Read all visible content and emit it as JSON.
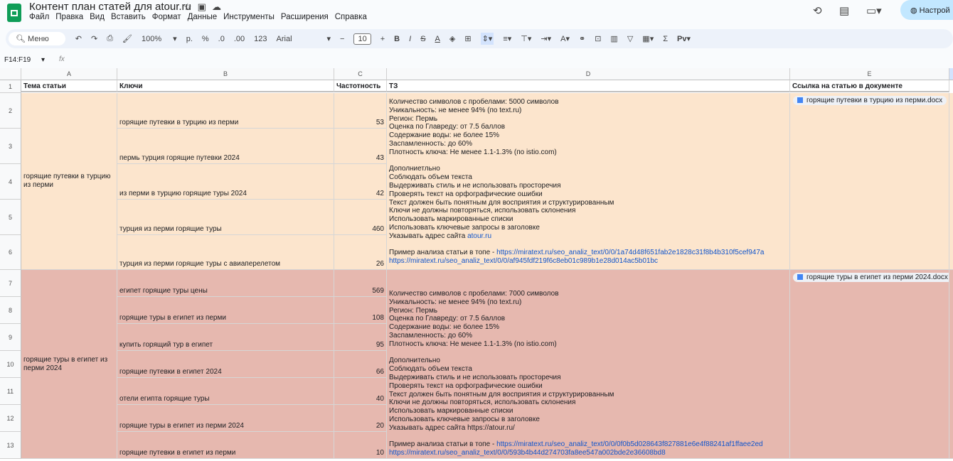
{
  "title": "Контент план статей для atour.ru",
  "menu": [
    "Файл",
    "Правка",
    "Вид",
    "Вставить",
    "Формат",
    "Данные",
    "Инструменты",
    "Расширения",
    "Справка"
  ],
  "share_label": "Настрой",
  "toolbar": {
    "search": "Меню",
    "zoom": "100%",
    "currency": "р.",
    "percent": "%",
    "dec_less": ".0",
    "dec_more": ".00",
    "format123": "123",
    "font": "Arial",
    "font_size": "10"
  },
  "name_box": "F14:F19",
  "fx": "fx",
  "columns": [
    "A",
    "B",
    "C",
    "D",
    "E"
  ],
  "headers": [
    "Тема статьи",
    "Ключи",
    "Частотность",
    "ТЗ",
    "Ссылка на статью в документе"
  ],
  "row_numbers": [
    "1",
    "2",
    "3",
    "4",
    "5",
    "6",
    "7",
    "8",
    "9",
    "10",
    "11",
    "12",
    "13"
  ],
  "groups": [
    {
      "topic": "горящие путевки в турцию из перми",
      "keys": [
        [
          "горящие путевки в турцию из перми",
          "53"
        ],
        [
          "пермь турция горящие путевки 2024",
          "43"
        ],
        [
          "из перми в турцию горящие туры 2024",
          "42"
        ],
        [
          "турция из перми горящие туры",
          "460"
        ],
        [
          "турция из перми горящие туры с авиаперелетом",
          "26"
        ]
      ],
      "tz": "Количество символов с пробелами: 5000 символов\nУникальность: не менее 94% (по text.ru)\nРегион: Пермь\nОценка по Главреду: от 7.5 баллов\nСодержание воды: не более 15%\nЗаспамленность: до 60%\nПлотность ключа: Не менее 1.1-1.3% (по istio.com)\n\nДополниетльно\nСоблюдать объем текста\nВыдерживать стиль и не использовать просторечия\nПроверять текст на орфографические ошибки\nТекст должен быть понятным для восприятия и структурированным\nКлючи не должны повторяться, использовать склонения\nИспользовать маркированные списки\nИспользовать ключевые запросы в заголовке\nУказывать адрес сайта ",
      "tz_site_link": "atour.ru",
      "tz_example_prefix": "Пример анализа статьи в топе - ",
      "tz_links": [
        "https://miratext.ru/seo_analiz_text/0/0/1a74d48f651fab2e1828c31f8b4b310f5cef947a",
        "https://miratext.ru/seo_analiz_text/0/0/af945fdf219f6c8eb01c989b1e28d014ac5b01bc"
      ],
      "doc": "горящие путевки в турцию из перми.docx"
    },
    {
      "topic": "горящие туры в египет из перми 2024",
      "keys": [
        [
          "египет горящие туры цены",
          "569"
        ],
        [
          "горящие туры в египет из перми",
          "108"
        ],
        [
          "купить горящий тур в египет",
          "95"
        ],
        [
          "горящие путевки в египет 2024",
          "66"
        ],
        [
          "отели египта горящие туры",
          "40"
        ],
        [
          "горящие туры в египет из перми 2024",
          "20"
        ],
        [
          "горящие путевки в египет из перми",
          "10"
        ]
      ],
      "tz": "Количество символов с пробелами: 7000 символов\nУникальность: не менее 94% (по text.ru)\nРегион: Пермь\nОценка по Главреду: от 7.5 баллов\nСодержание воды: не более 15%\nЗаспамленность: до 60%\nПлотность ключа: Не менее 1.1-1.3% (по istio.com)\n\nДополнительно\nСоблюдать объем текста\nВыдерживать стиль и не использовать просторечия\nПроверять текст на орфографические ошибки\nТекст должен быть понятным для восприятия и структурированным\nКлючи не должны повторяться, использовать склонения\nИспользовать маркированные списки\nИспользовать ключевые запросы в заголовке\nУказывать адрес сайта https://atour.ru/",
      "tz_site_link": "",
      "tz_example_prefix": "Пример анализа статьи в топе - ",
      "tz_links": [
        "https://miratext.ru/seo_analiz_text/0/0/0f0b5d028643f827881e6e4f88241af1ffaee2ed",
        "https://miratext.ru/seo_analiz_text/0/0/593b4b44d274703fa8ee547a002bde2e36608bd8"
      ],
      "doc": "горящие туры в египет из перми 2024.docx"
    }
  ]
}
